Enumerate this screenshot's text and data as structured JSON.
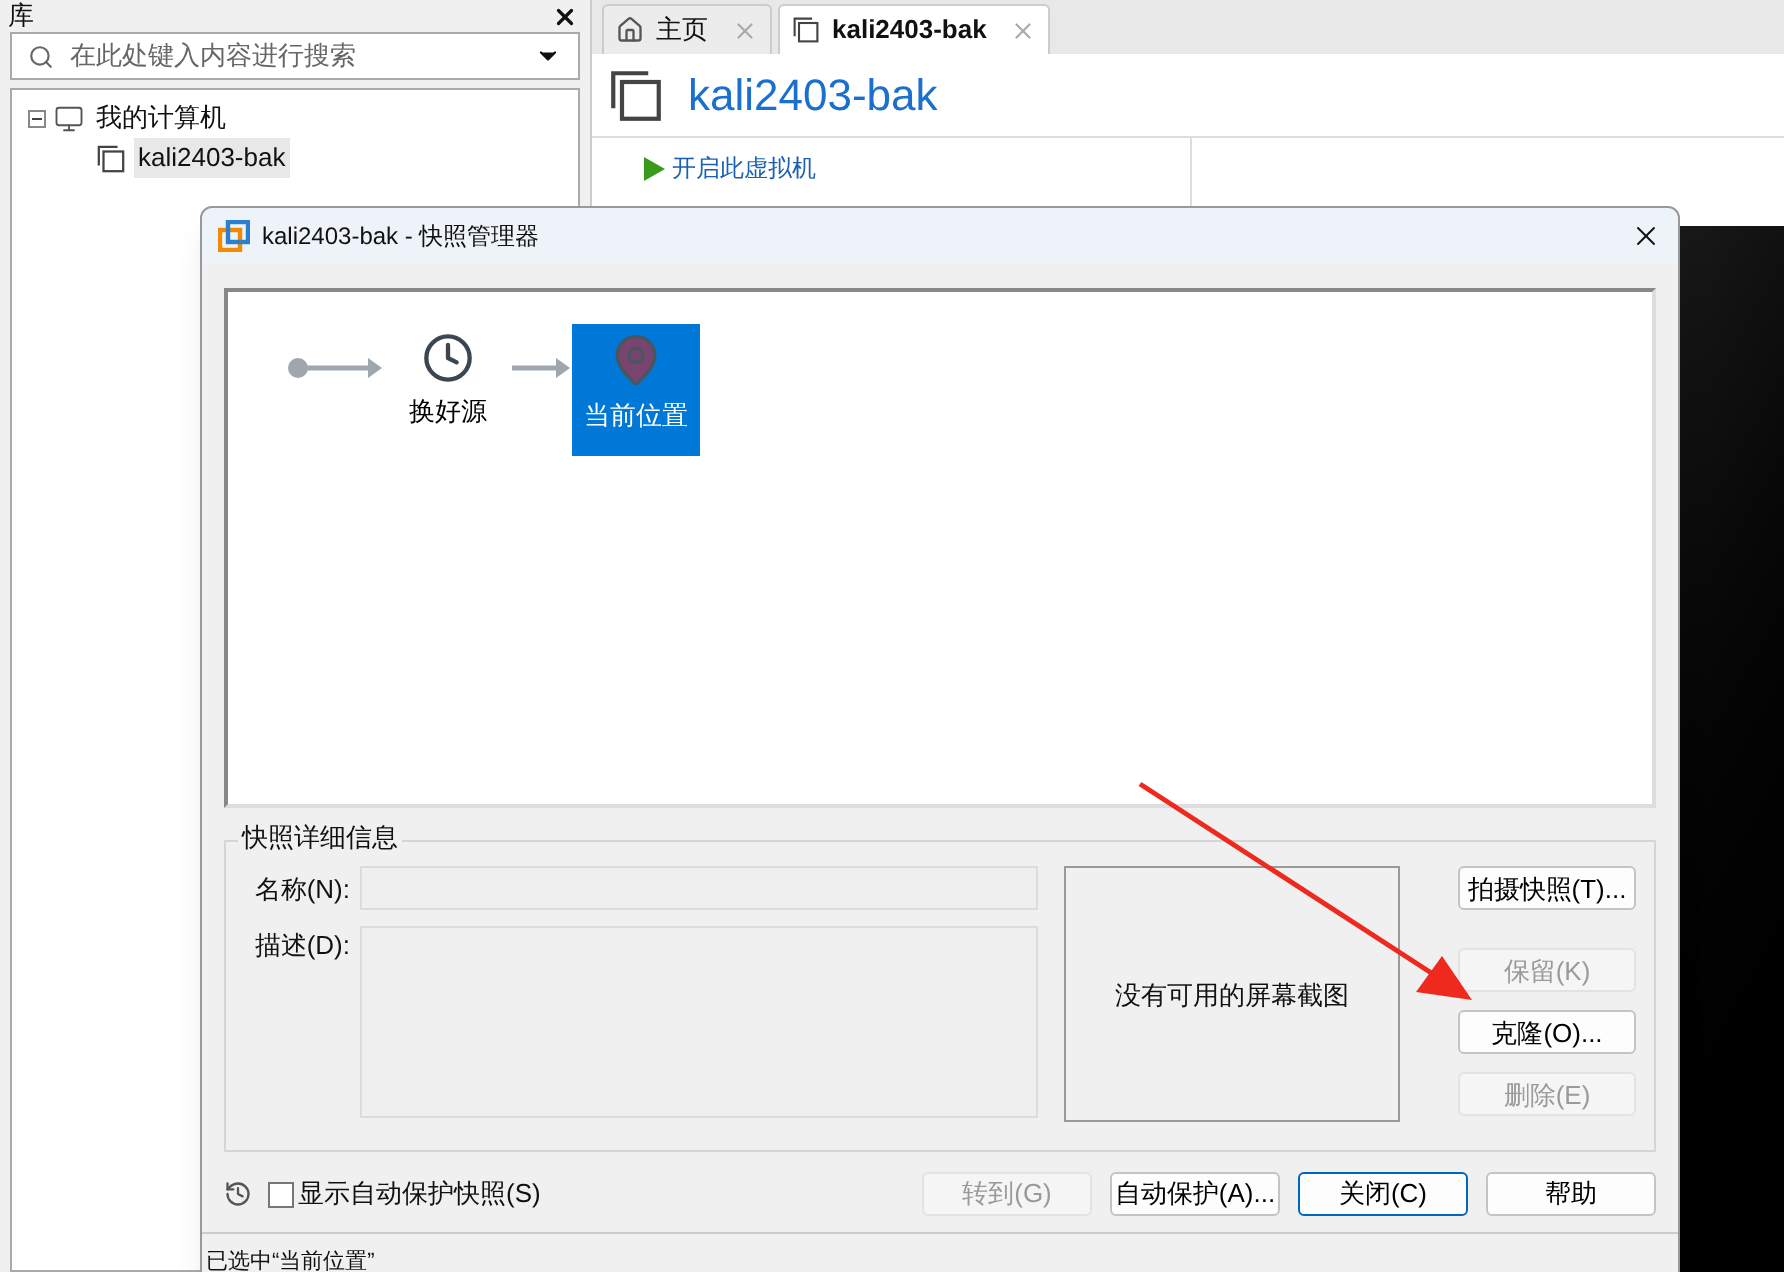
{
  "library": {
    "title": "库",
    "search": {
      "placeholder": "在此处键入内容进行搜索"
    },
    "tree": [
      {
        "label": "我的计算机",
        "expanded": true,
        "selected": false,
        "children": [
          {
            "label": "kali2403-bak",
            "selected": true
          }
        ]
      }
    ]
  },
  "tabs": [
    {
      "label": "主页",
      "kind": "home",
      "selected": false
    },
    {
      "label": "kali2403-bak",
      "kind": "vm",
      "selected": true
    }
  ],
  "vm": {
    "title": "kali2403-bak",
    "actions": [
      "开启此虚拟机"
    ]
  },
  "dialog": {
    "title": "kali2403-bak - 快照管理器",
    "snapshots": [
      {
        "label": "换好源",
        "kind": "snapshot",
        "selected": false
      },
      {
        "label": "当前位置",
        "kind": "current",
        "selected": true
      }
    ],
    "details": {
      "title": "快照详细信息",
      "name_label": "名称(N):",
      "description_label": "描述(D):",
      "screenshot_text": "没有可用的屏幕截图"
    },
    "side_buttons": [
      {
        "label": "拍摄快照(T)...",
        "disabled": false
      },
      {
        "label": "保留(K)",
        "disabled": true
      },
      {
        "label": "克隆(O)...",
        "disabled": false
      },
      {
        "label": "删除(E)",
        "disabled": true
      }
    ],
    "show_autoprotect": {
      "label": "显示自动保护快照(S)",
      "checked": false
    },
    "bottom_buttons": [
      {
        "label": "转到(G)",
        "disabled": true,
        "default": false
      },
      {
        "label": "自动保护(A)...",
        "disabled": false,
        "default": false
      },
      {
        "label": "关闭(C)",
        "disabled": false,
        "default": true
      },
      {
        "label": "帮助",
        "disabled": false,
        "default": false
      }
    ]
  },
  "status": "已选中“当前位置”"
}
